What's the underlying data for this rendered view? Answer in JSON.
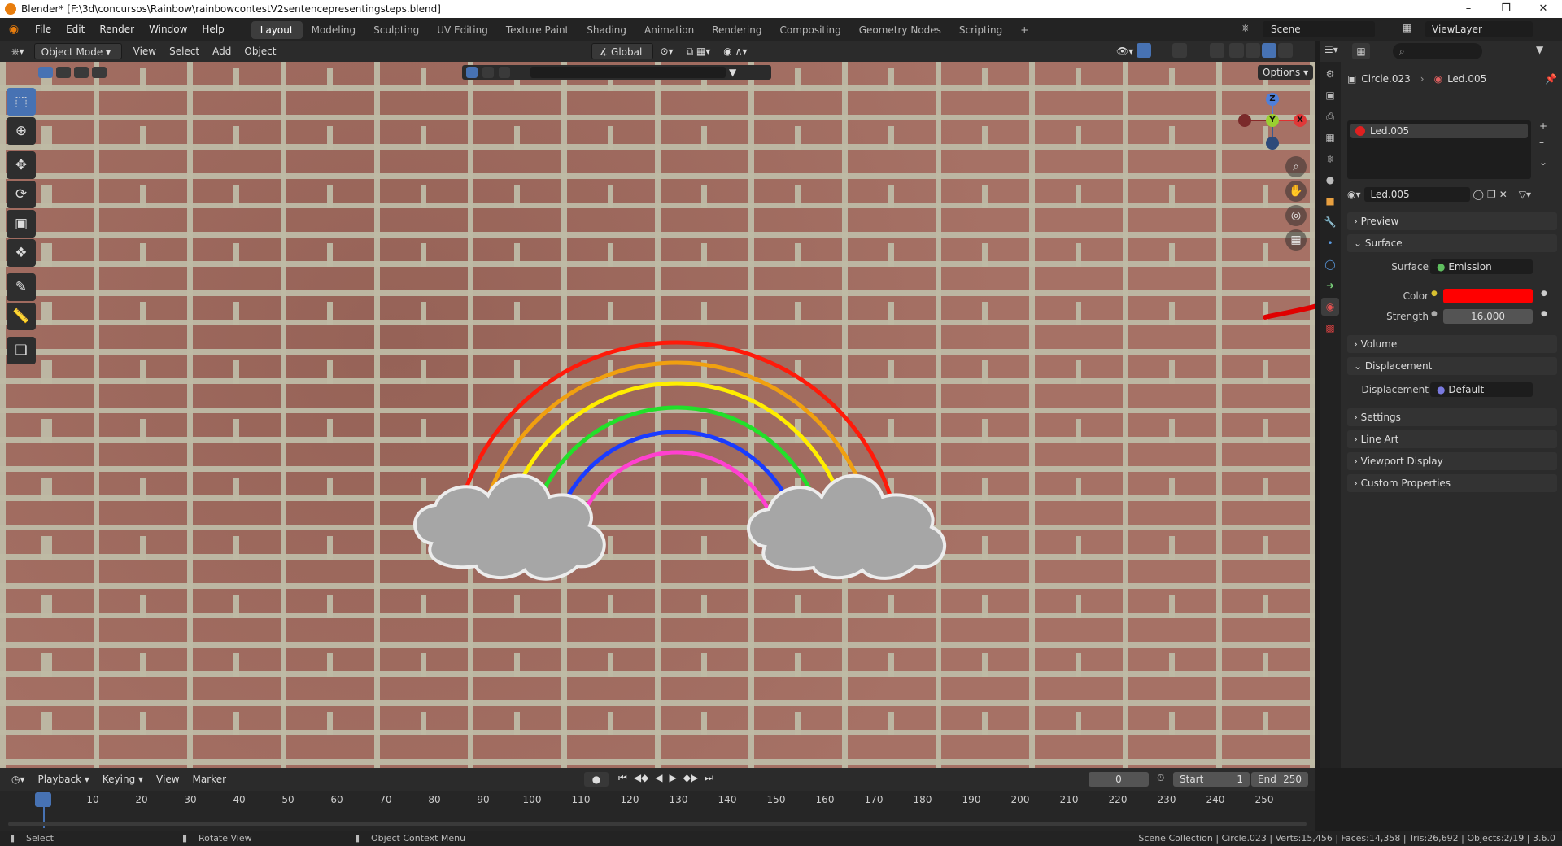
{
  "window": {
    "title": "Blender* [F:\\3d\\concursos\\Rainbow\\rainbowcontestV2sentencepresentingsteps.blend]"
  },
  "menu": [
    "File",
    "Edit",
    "Render",
    "Window",
    "Help"
  ],
  "workspaces": [
    "Layout",
    "Modeling",
    "Sculpting",
    "UV Editing",
    "Texture Paint",
    "Shading",
    "Animation",
    "Rendering",
    "Compositing",
    "Geometry Nodes",
    "Scripting"
  ],
  "active_workspace": "Layout",
  "scene": {
    "scene_label": "Scene",
    "view_layer": "ViewLayer"
  },
  "viewport_header": {
    "mode": "Object Mode",
    "menus": [
      "View",
      "Select",
      "Add",
      "Object"
    ],
    "orientation": "Global",
    "options": "Options"
  },
  "gizmo": {
    "z": "Z",
    "y": "Y",
    "x": "X"
  },
  "properties": {
    "breadcrumb_object": "Circle.023",
    "breadcrumb_material": "Led.005",
    "slot_name": "Led.005",
    "material_name": "Led.005",
    "panels": {
      "preview": "Preview",
      "surface": "Surface",
      "volume": "Volume",
      "displacement": "Displacement",
      "settings": "Settings",
      "line_art": "Line Art",
      "viewport_display": "Viewport Display",
      "custom_properties": "Custom Properties"
    },
    "surface_label": "Surface",
    "surface_value": "Emission",
    "color_label": "Color",
    "color_value": "#ff0000",
    "strength_label": "Strength",
    "strength_value": "16.000",
    "displacement_label": "Displacement",
    "displacement_value": "Default"
  },
  "timeline": {
    "menus": [
      "Playback",
      "Keying",
      "View",
      "Marker"
    ],
    "current_frame": "0",
    "start_label": "Start",
    "start_value": "1",
    "end_label": "End",
    "end_value": "250",
    "ticks": [
      "0",
      "10",
      "20",
      "30",
      "40",
      "50",
      "60",
      "70",
      "80",
      "90",
      "100",
      "110",
      "120",
      "130",
      "140",
      "150",
      "160",
      "170",
      "180",
      "190",
      "200",
      "210",
      "220",
      "230",
      "240",
      "250"
    ]
  },
  "statusbar": {
    "select": "Select",
    "rotate": "Rotate View",
    "context": "Object Context Menu",
    "stats": "Scene Collection | Circle.023 | Verts:15,456 | Faces:14,358 | Tris:26,692 | Objects:2/19 | 3.6.0"
  },
  "colors": {
    "rainbow": [
      "#ff1a0a",
      "#f0a010",
      "#ffee00",
      "#22e02a",
      "#1a3cff",
      "#ff40d0"
    ],
    "accent": "#4772b3",
    "annotation": "#e00000"
  }
}
